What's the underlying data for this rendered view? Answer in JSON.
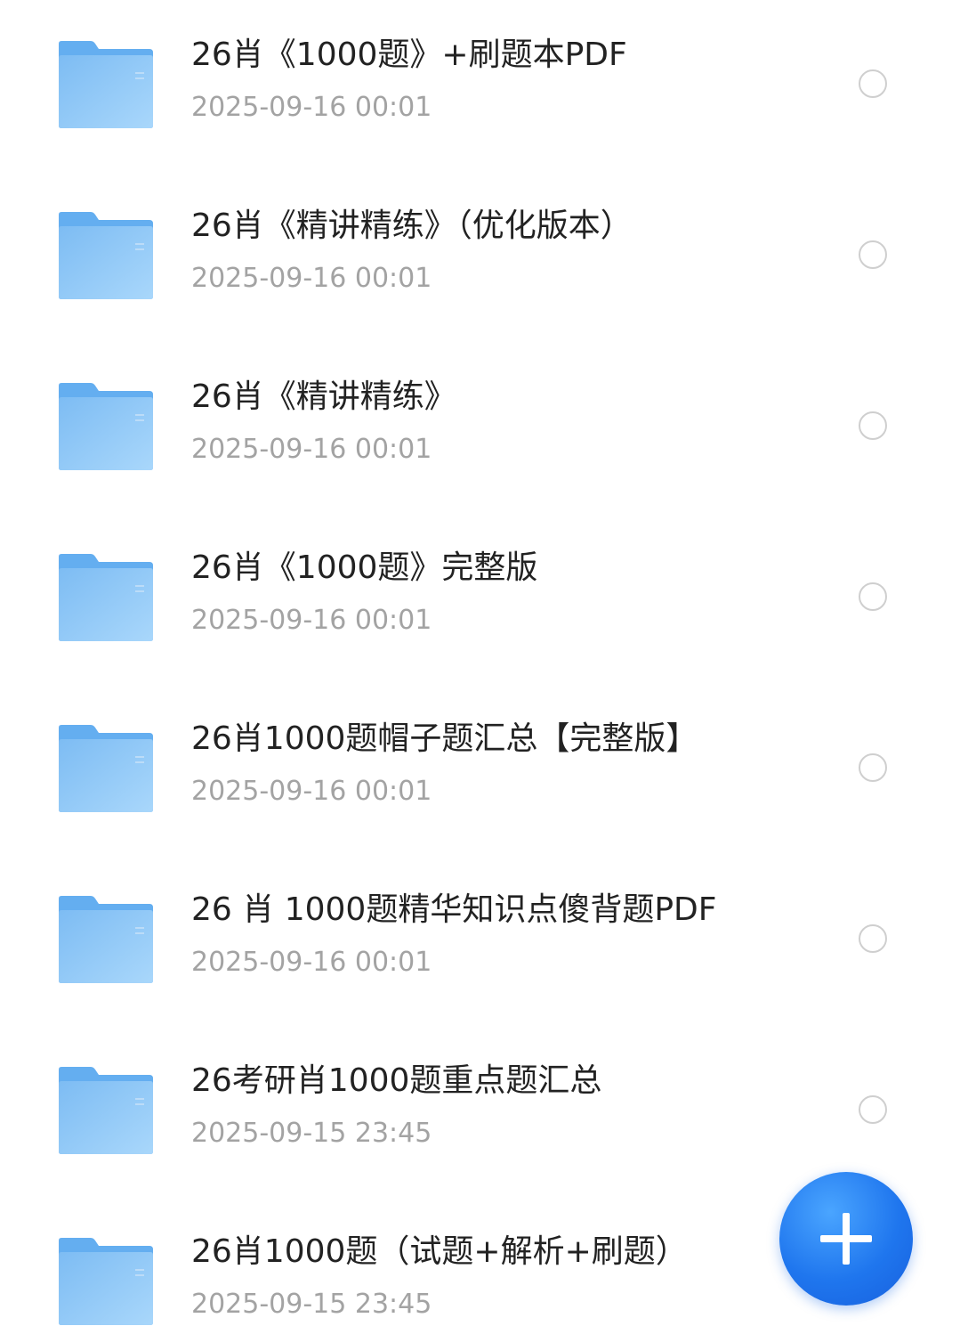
{
  "files": [
    {
      "name": "26肖《1000题》+刷题本PDF",
      "date": "2025-09-16 00:01",
      "icon": "folder-icon"
    },
    {
      "name": "26肖《精讲精练》（优化版本）",
      "date": "2025-09-16 00:01",
      "icon": "folder-icon"
    },
    {
      "name": "26肖《精讲精练》",
      "date": "2025-09-16 00:01",
      "icon": "folder-icon"
    },
    {
      "name": "26肖《1000题》完整版",
      "date": "2025-09-16 00:01",
      "icon": "folder-icon"
    },
    {
      "name": "26肖1000题帽子题汇总【完整版】",
      "date": "2025-09-16 00:01",
      "icon": "folder-icon"
    },
    {
      "name": "26 肖 1000题精华知识点傻背题PDF",
      "date": "2025-09-16 00:01",
      "icon": "folder-icon"
    },
    {
      "name": "26考研肖1000题重点题汇总",
      "date": "2025-09-15 23:45",
      "icon": "folder-icon"
    },
    {
      "name": "26肖1000题（试题+解析+刷题）",
      "date": "2025-09-15 23:45",
      "icon": "folder-icon"
    }
  ],
  "fab": {
    "icon": "plus-icon",
    "color": "#1f76ee"
  },
  "colors": {
    "folder": "#8ec7f5",
    "folder_tab": "#64aef0",
    "name_text": "#222222",
    "date_text": "#a3a3a3",
    "radio_border": "#cfcfcf"
  }
}
